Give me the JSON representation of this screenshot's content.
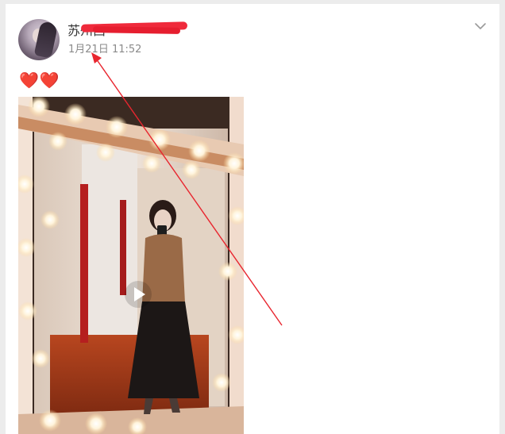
{
  "post": {
    "username": "苏州西",
    "timestamp": "1月21日 11:52",
    "hearts": "❤️❤️",
    "icons": {
      "avatar": "user-avatar",
      "menu": "chevron-down-icon",
      "play": "play-icon"
    }
  },
  "colors": {
    "card_bg": "#ffffff",
    "page_bg": "#ececec",
    "annotation": "#e8262f",
    "timestamp": "#8a8a8a"
  }
}
